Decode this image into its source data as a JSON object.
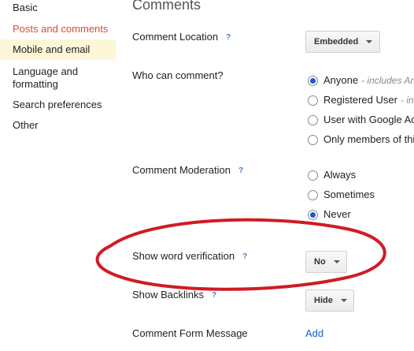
{
  "sidebar": {
    "items": [
      {
        "label": "Basic"
      },
      {
        "label": "Posts and comments"
      },
      {
        "label": "Mobile and email"
      },
      {
        "label": "Language and formatting"
      },
      {
        "label": "Search preferences"
      },
      {
        "label": "Other"
      }
    ],
    "active_color": "#dd4b39",
    "highlight_color": "#fdf6d7"
  },
  "main": {
    "section_title": "Comments",
    "help_glyph": "?",
    "comment_location": {
      "label": "Comment Location",
      "value": "Embedded"
    },
    "who_can_comment": {
      "label": "Who can comment?",
      "options": [
        {
          "label": "Anyone",
          "note": "- includes An",
          "checked": true
        },
        {
          "label": "Registered User",
          "note": "- in",
          "checked": false
        },
        {
          "label": "User with Google Ac",
          "note": "",
          "checked": false
        },
        {
          "label": "Only members of thi",
          "note": "",
          "checked": false
        }
      ]
    },
    "comment_moderation": {
      "label": "Comment Moderation",
      "options": [
        {
          "label": "Always",
          "checked": false
        },
        {
          "label": "Sometimes",
          "checked": false
        },
        {
          "label": "Never",
          "checked": true
        }
      ]
    },
    "word_verification": {
      "label": "Show word verification",
      "value": "No"
    },
    "backlinks": {
      "label": "Show Backlinks",
      "value": "Hide"
    },
    "comment_form_message": {
      "label": "Comment Form Message",
      "action": "Add"
    }
  },
  "annotation_color": "#d11a24",
  "radio_checked_color": "#1a5dc9"
}
